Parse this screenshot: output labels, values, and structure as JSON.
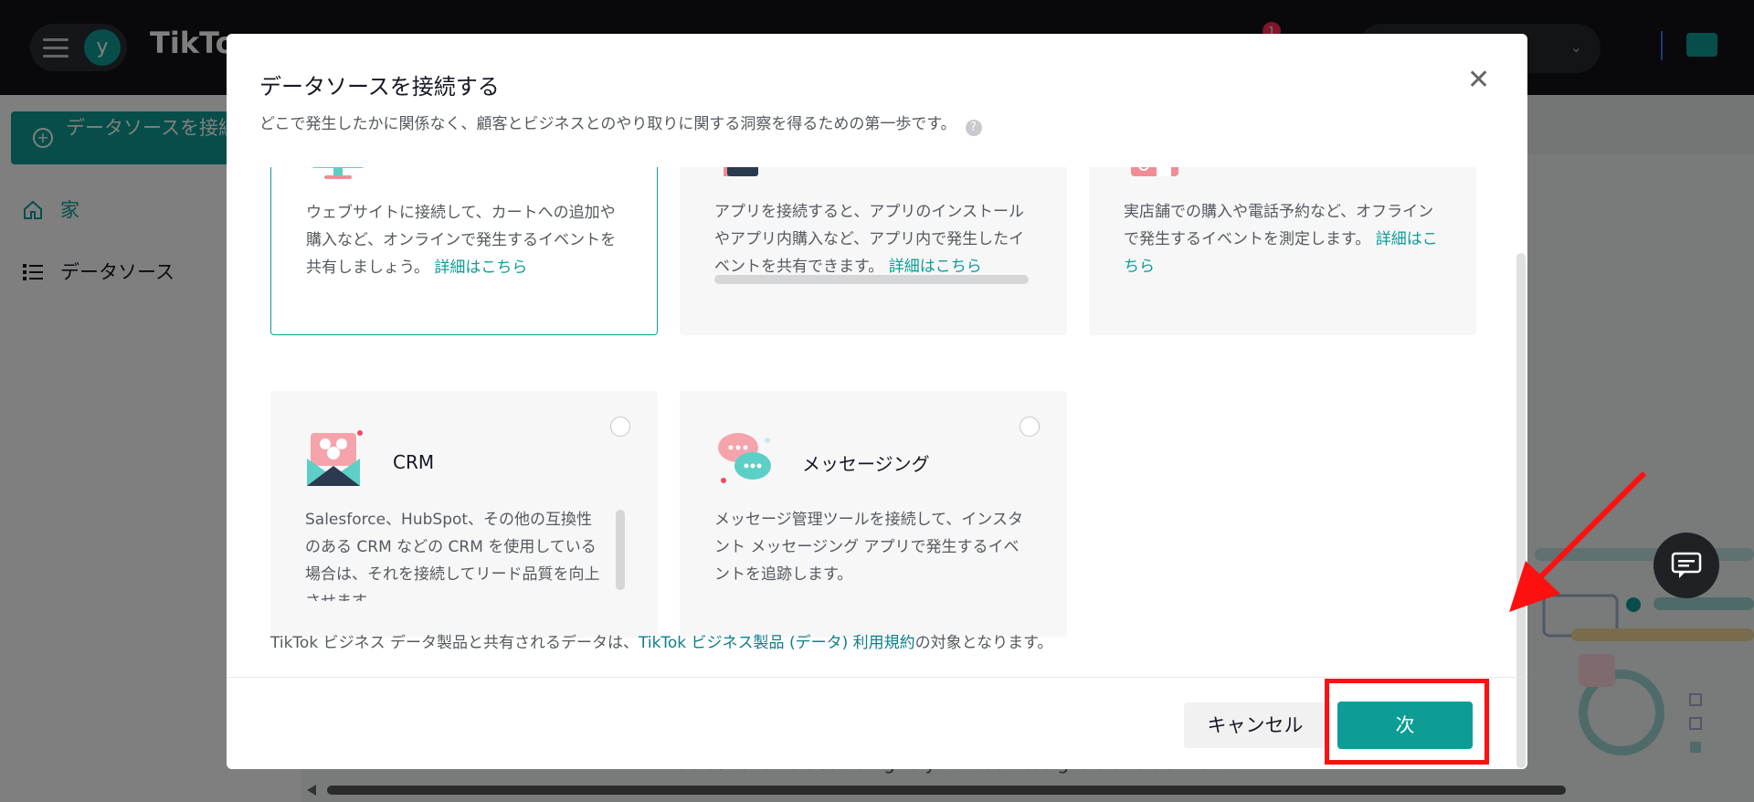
{
  "app": {
    "brand": "TikTo",
    "avatar_letter": "y",
    "notification_count": "1",
    "accent_color": "#0e9d95"
  },
  "sidebar": {
    "connect_label": "データソースを接続する",
    "items": [
      {
        "label": "家",
        "icon": "home-icon"
      },
      {
        "label": "データソース",
        "icon": "list-icon"
      }
    ]
  },
  "background": {
    "caption": "Select events according to your business goals and define how"
  },
  "modal": {
    "title": "データソースを接続する",
    "subtitle": "どこで発生したかに関係なく、顧客とビジネスとのやり取りに関する洞察を得るための第一歩です。",
    "cards": [
      {
        "title": "",
        "desc": "ウェブサイトに接続して、カートへの追加や購入など、オンラインで発生するイベントを共有しましょう。",
        "link": "詳細はこちら",
        "selected": true
      },
      {
        "title": "",
        "desc": "アプリを接続すると、アプリのインストールやアプリ内購入など、アプリ内で発生したイベントを共有できます。",
        "link": "詳細はこちら",
        "selected": false
      },
      {
        "title": "",
        "desc": "実店舗での購入や電話予約など、オフラインで発生するイベントを測定します。",
        "link": "詳細はこちら",
        "selected": false
      },
      {
        "title": "CRM",
        "desc": "Salesforce、HubSpot、その他の互換性のある CRM などの CRM を使用している場合は、それを接続してリード品質を向上させます",
        "link": "",
        "selected": false
      },
      {
        "title": "メッセージング",
        "desc": "メッセージ管理ツールを接続して、インスタント メッセージング アプリで発生するイベントを追跡します。",
        "link": "",
        "selected": false
      }
    ],
    "footer_prefix": "TikTok ビジネス データ製品と共有されるデータは、",
    "footer_link": "TikTok ビジネス製品 (データ) 利用規約",
    "footer_suffix": "の対象となります。",
    "cancel_label": "キャンセル",
    "next_label": "次"
  }
}
